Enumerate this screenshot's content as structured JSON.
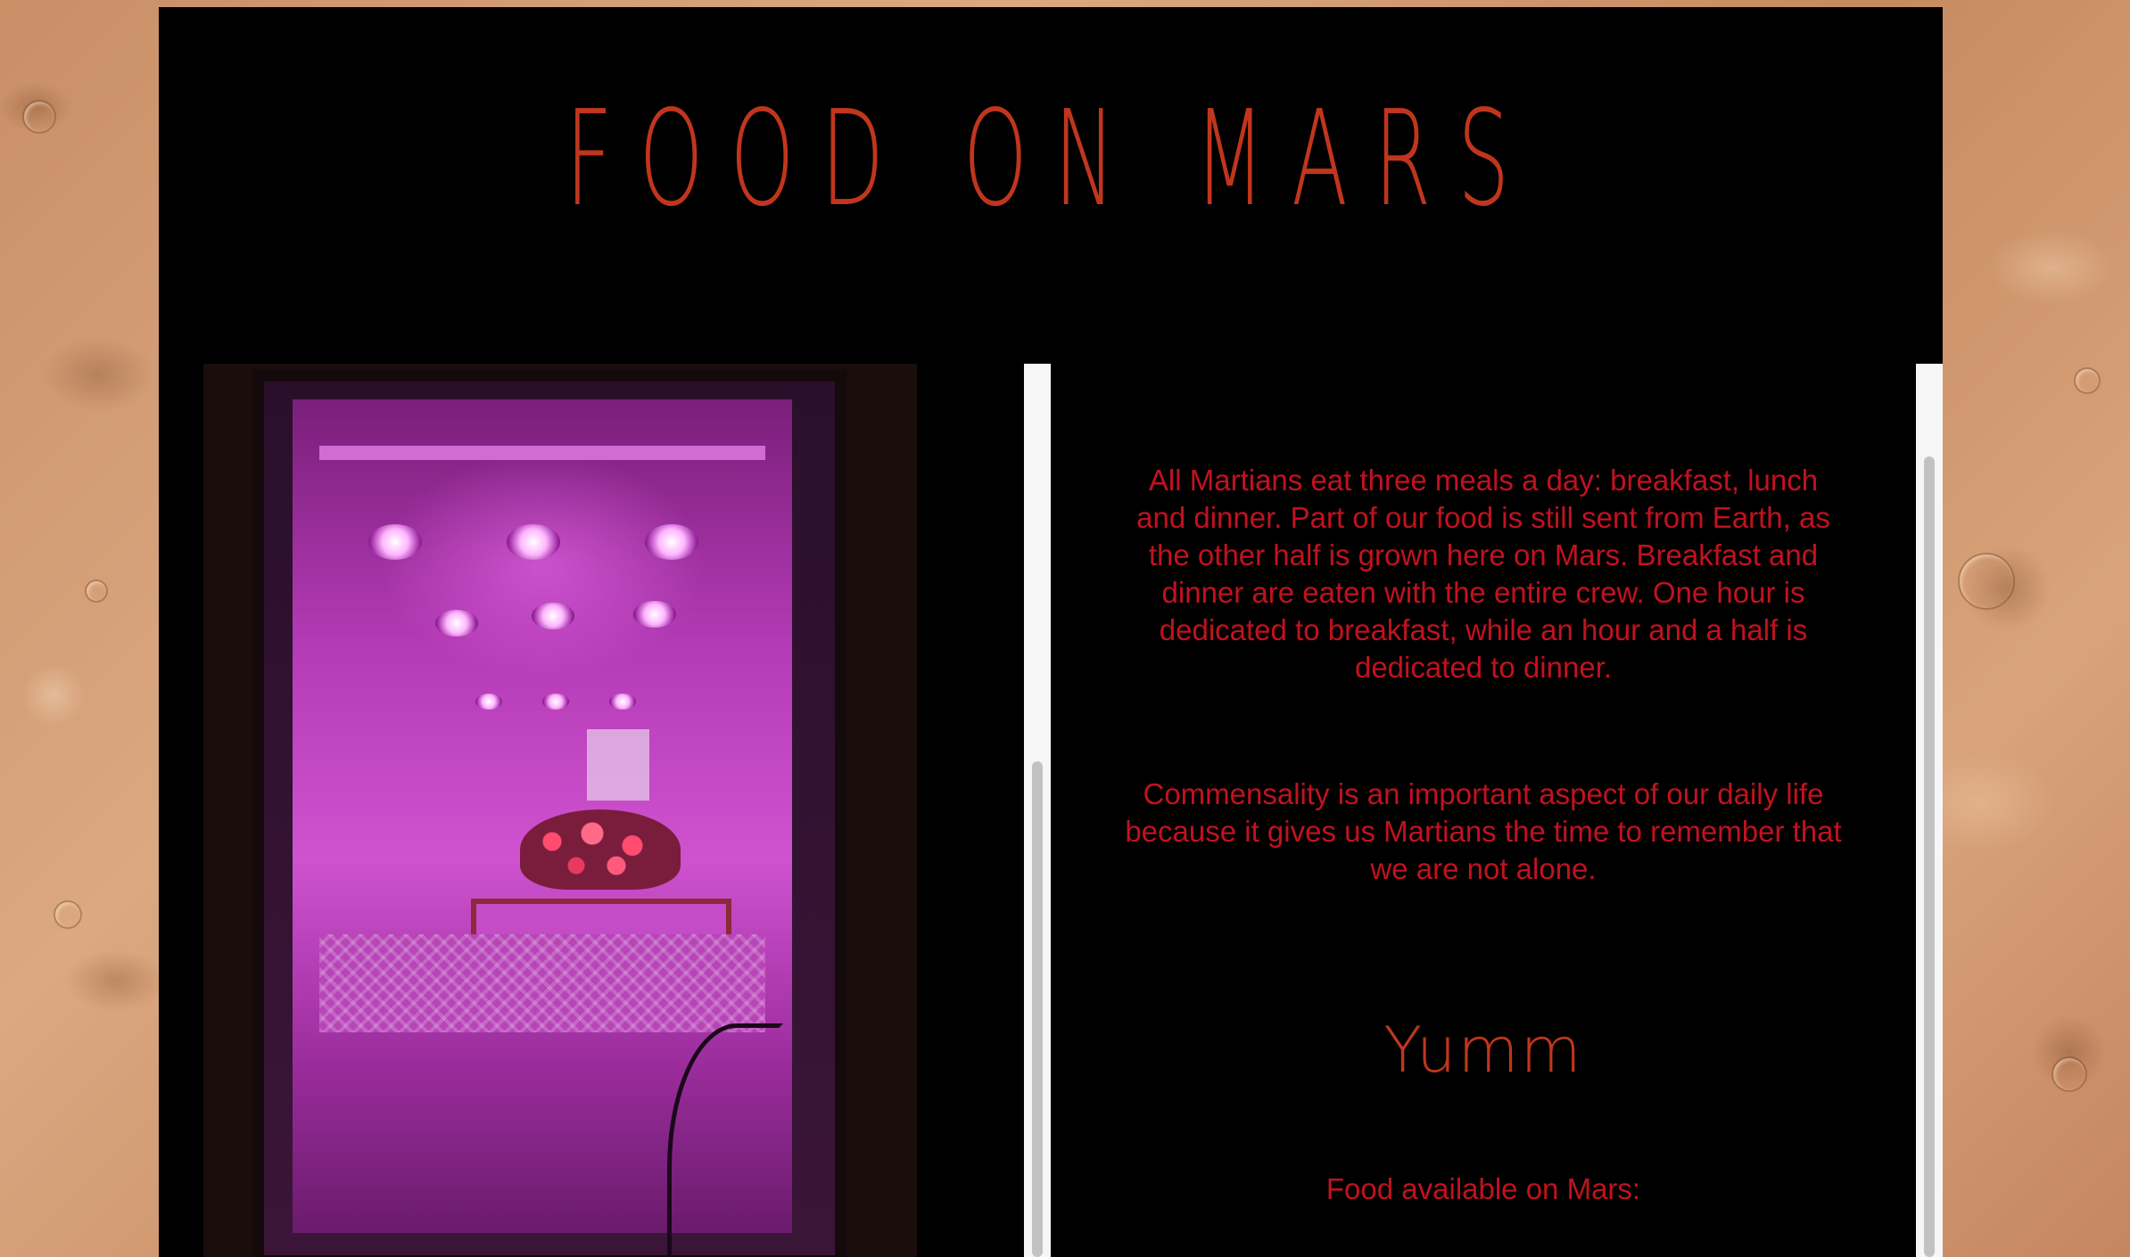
{
  "header": {
    "title": "FOOD ON MARS"
  },
  "image": {
    "alt": "Indoor grow chamber lit with magenta LED lights and flowering plants"
  },
  "content": {
    "paragraph_1": "All Martians eat three meals a day: breakfast, lunch and dinner. Part of our food is still sent from Earth, as the other half is grown here on Mars. Breakfast and dinner are eaten with the entire crew. One hour is dedicated to breakfast, while an hour and a half is dedicated to dinner.",
    "paragraph_2": "Commensality is an important aspect of our daily life because it gives us Martians the time to remember that we are not alone.",
    "heading": "Yumm",
    "food_label": "Food available on Mars:"
  },
  "colors": {
    "accent": "#c0361d",
    "body_text": "#c1121f",
    "panel_background": "#000000",
    "scrollbar_track": "#f6f6f6",
    "scrollbar_thumb": "#c2c2c2"
  }
}
